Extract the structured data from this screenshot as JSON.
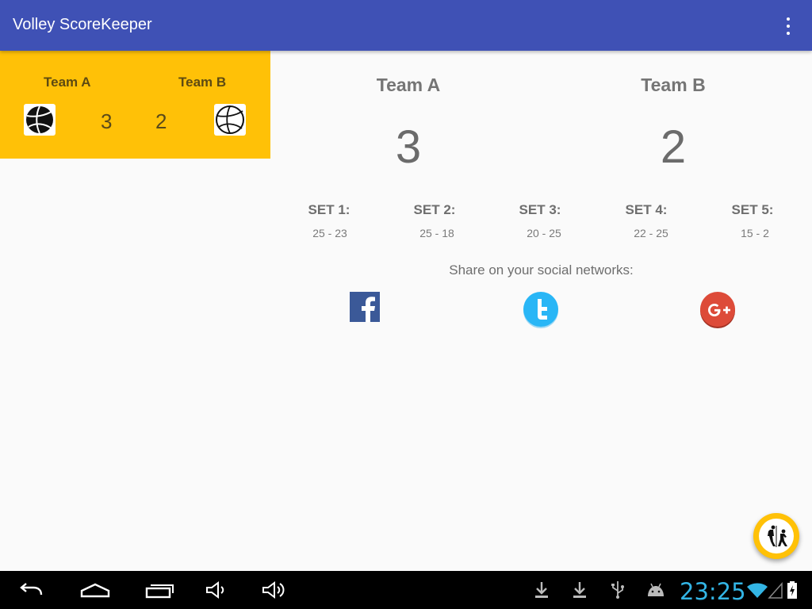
{
  "app": {
    "title": "Volley ScoreKeeper"
  },
  "summary": {
    "team_a_name": "Team A",
    "team_b_name": "Team B",
    "team_a_sets": "3",
    "team_b_sets": "2"
  },
  "main": {
    "team_a_name": "Team A",
    "team_b_name": "Team B",
    "team_a_score": "3",
    "team_b_score": "2",
    "sets": [
      {
        "label": "SET 1:",
        "score": "25 - 23"
      },
      {
        "label": "SET 2:",
        "score": "25 - 18"
      },
      {
        "label": "SET 3:",
        "score": "20 - 25"
      },
      {
        "label": "SET 4:",
        "score": "22 - 25"
      },
      {
        "label": "SET 5:",
        "score": "15 - 2"
      }
    ],
    "share_label": "Share on your social networks:",
    "social": [
      "facebook-icon",
      "twitter-icon",
      "google-plus-icon"
    ]
  },
  "status_bar": {
    "time": "23:25"
  },
  "colors": {
    "app_bar": "#3f51b5",
    "accent": "#ffc107",
    "clock": "#33b5e5",
    "facebook": "#3b5998",
    "twitter": "#1da1f2",
    "google_plus": "#dd4b39"
  }
}
